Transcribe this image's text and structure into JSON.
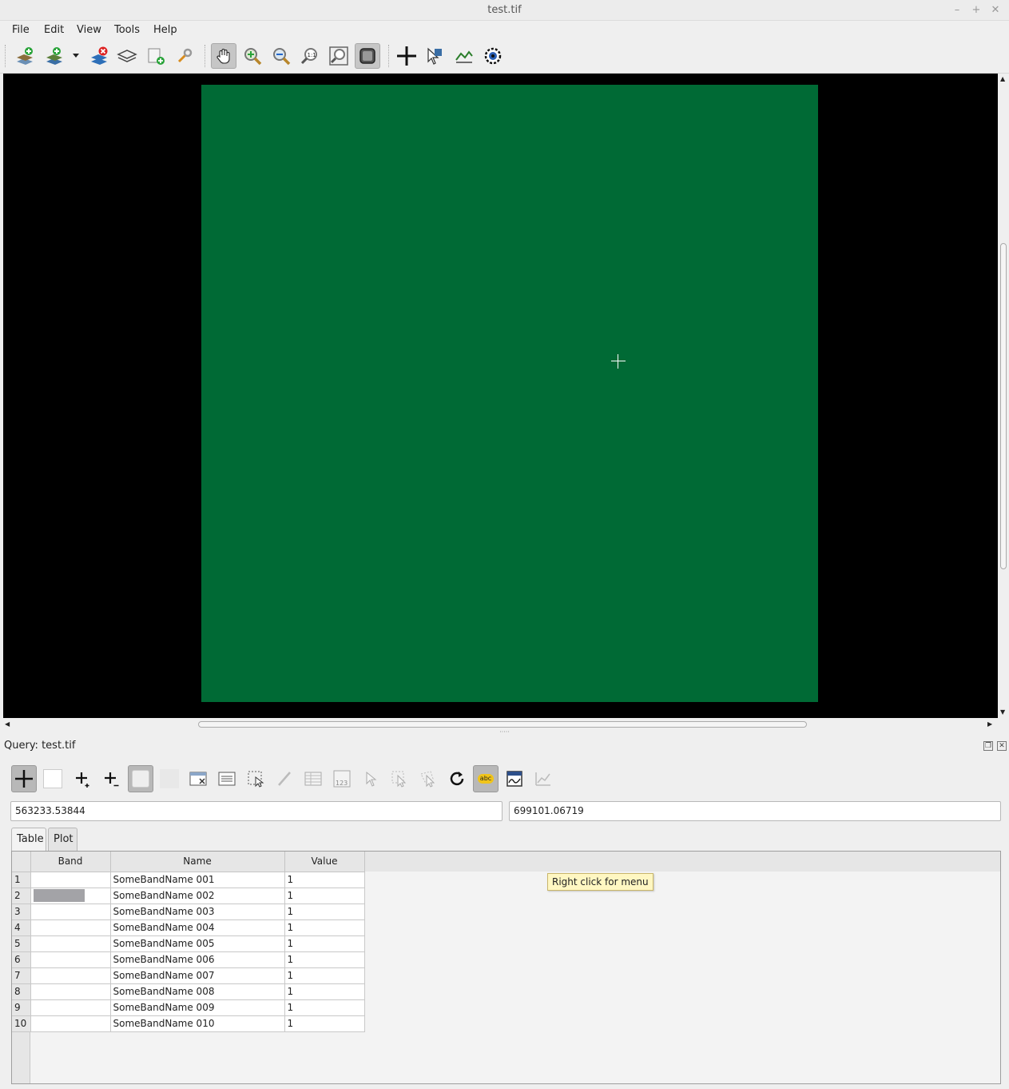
{
  "window": {
    "title": "test.tif",
    "minimize": "–",
    "maximize": "+",
    "close": "✕"
  },
  "menu": [
    "File",
    "Edit",
    "View",
    "Tools",
    "Help"
  ],
  "toolbar_icons": [
    "add-layer-icon",
    "add-layer-options-icon",
    "dropdown-icon",
    "remove-layer-icon",
    "layers-icon",
    "new-window-icon",
    "properties-icon",
    "pan-icon",
    "zoom-in-icon",
    "zoom-out-icon",
    "zoom-native-icon",
    "zoom-full-icon",
    "follow-extent-icon",
    "query-icon",
    "vector-query-icon",
    "profile-icon",
    "flicker-icon"
  ],
  "raster_color": "#006a35",
  "dock": {
    "title": "Query: test.tif"
  },
  "coords": {
    "easting": "563233.53844",
    "northing": "699101.06719"
  },
  "tabs": [
    "Table",
    "Plot"
  ],
  "table": {
    "headers": [
      "Band",
      "Name",
      "Value"
    ],
    "rows": [
      {
        "n": "1",
        "name": "SomeBandName 001",
        "value": "1"
      },
      {
        "n": "2",
        "name": "SomeBandName 002",
        "value": "1"
      },
      {
        "n": "3",
        "name": "SomeBandName 003",
        "value": "1"
      },
      {
        "n": "4",
        "name": "SomeBandName 004",
        "value": "1"
      },
      {
        "n": "5",
        "name": "SomeBandName 005",
        "value": "1"
      },
      {
        "n": "6",
        "name": "SomeBandName 006",
        "value": "1"
      },
      {
        "n": "7",
        "name": "SomeBandName 007",
        "value": "1"
      },
      {
        "n": "8",
        "name": "SomeBandName 008",
        "value": "1"
      },
      {
        "n": "9",
        "name": "SomeBandName 009",
        "value": "1"
      },
      {
        "n": "10",
        "name": "SomeBandName 010",
        "value": "1"
      }
    ]
  },
  "tooltip": "Right click for menu"
}
